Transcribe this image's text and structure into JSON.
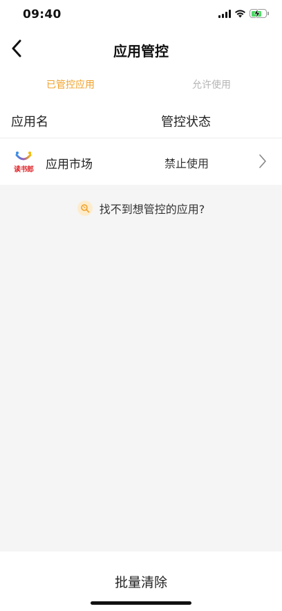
{
  "status_bar": {
    "time": "09:40",
    "icons": [
      "signal-icon",
      "wifi-icon",
      "battery-charging-icon"
    ],
    "battery_color": "#4cd964"
  },
  "nav": {
    "title": "应用管控",
    "back_icon": "chevron-left-icon"
  },
  "tabs": [
    {
      "label": "已管控应用",
      "active": true
    },
    {
      "label": "允许使用",
      "active": false
    }
  ],
  "table": {
    "headers": [
      "应用名",
      "管控状态"
    ],
    "rows": [
      {
        "logo_icon": "app-market-logo",
        "logo_text": "读书郎",
        "name": "应用市场",
        "status": "禁止使用"
      }
    ]
  },
  "help": {
    "icon": "search-help-icon",
    "text": "找不到想管控的应用?"
  },
  "footer": {
    "button_label": "批量清除"
  },
  "colors": {
    "accent": "#f0a028",
    "inactive_tab": "#b5b5b5",
    "background": "#f5f5f5"
  }
}
